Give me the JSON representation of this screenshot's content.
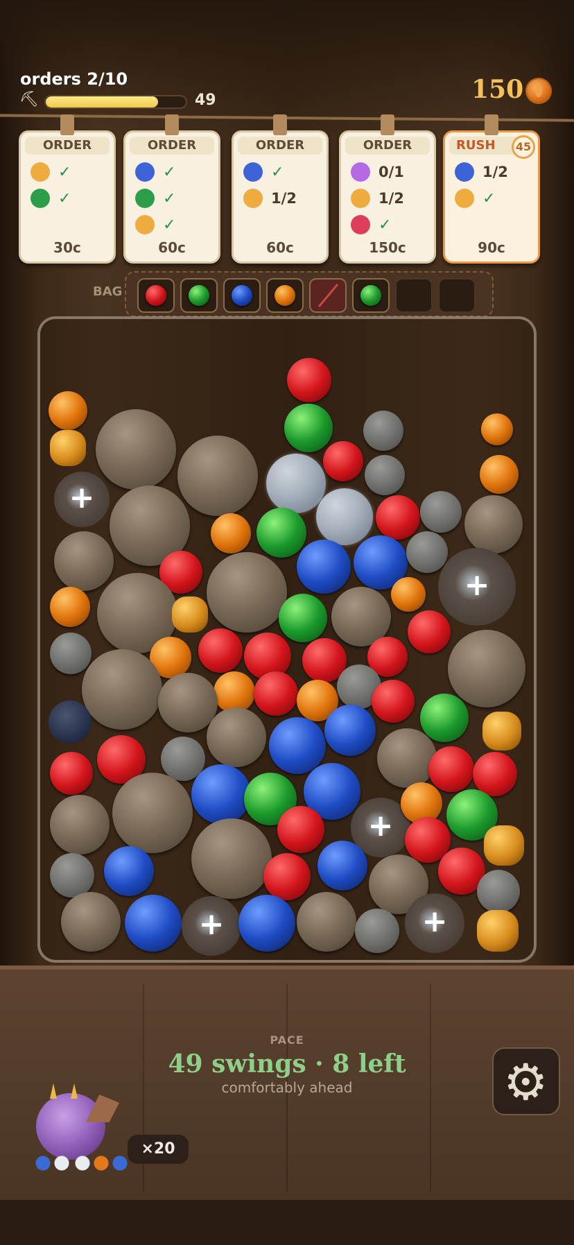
{
  "hud": {
    "orders_label": "orders 2/10",
    "swing_progress_value": 49,
    "swing_progress_fraction": 0.8,
    "coins": "150",
    "pick_icon": "pickaxe-icon",
    "coin_icon": "coin-icon"
  },
  "orders": [
    {
      "title": "ORDER",
      "price": "30c",
      "items": [
        {
          "gem": "orange",
          "status": "check"
        },
        {
          "gem": "green",
          "status": "check"
        }
      ]
    },
    {
      "title": "ORDER",
      "price": "60c",
      "items": [
        {
          "gem": "blue",
          "status": "check"
        },
        {
          "gem": "green",
          "status": "check"
        },
        {
          "gem": "orange",
          "status": "check"
        }
      ]
    },
    {
      "title": "ORDER",
      "price": "60c",
      "items": [
        {
          "gem": "blue",
          "status": "check"
        },
        {
          "gem": "orange",
          "status": "1/2"
        }
      ]
    },
    {
      "title": "ORDER",
      "price": "150c",
      "items": [
        {
          "gem": "purple",
          "status": "0/1"
        },
        {
          "gem": "orange",
          "status": "1/2"
        },
        {
          "gem": "red",
          "status": "check"
        }
      ]
    },
    {
      "title": "RUSH",
      "price": "90c",
      "timer": "45",
      "items": [
        {
          "gem": "blue",
          "status": "1/2"
        },
        {
          "gem": "orange",
          "status": "check"
        }
      ]
    }
  ],
  "check_mark": "✓",
  "bag": {
    "label": "BAG",
    "slots": [
      "red",
      "green",
      "blue",
      "orange",
      "red-crossed",
      "green",
      "empty",
      "empty"
    ]
  },
  "colors": {
    "red": "#d3161c",
    "green": "#1c9a2c",
    "blue": "#1f4cc4",
    "orange": "#e0740c",
    "purple": "#b46ae3",
    "pace_text": "#8ed08a",
    "coin": "#f4c25a"
  },
  "pace": {
    "label": "PACE",
    "main": "49 swings · 8 left",
    "sub": "comfortably ahead"
  },
  "settings_icon": "gear-icon",
  "dragon": {
    "icon": "sleeping-dragon-icon",
    "multiplier": "×20"
  }
}
